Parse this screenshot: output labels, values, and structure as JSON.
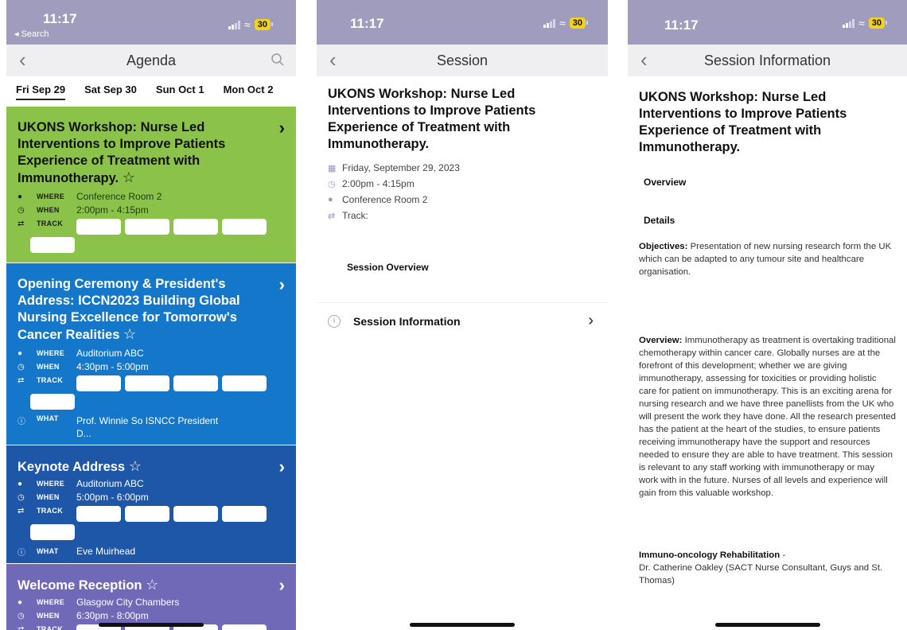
{
  "status": {
    "time": "11:17",
    "back_search": "◂ Search",
    "battery": "30"
  },
  "agenda": {
    "title": "Agenda",
    "days": [
      "Fri Sep 29",
      "Sat Sep 30",
      "Sun Oct 1",
      "Mon Oct 2"
    ],
    "labels": {
      "where": "WHERE",
      "when": "WHEN",
      "track": "TRACK",
      "what": "WHAT"
    },
    "sessions": [
      {
        "title": "UKONS Workshop: Nurse Led Interventions to Improve Patients Experience of Treatment with Immunotherapy.",
        "where": "Conference Room 2",
        "when": "2:00pm - 4:15pm",
        "color": "#8bc34a"
      },
      {
        "title": "Opening Ceremony & President's Address: ICCN2023 Building Global Nursing Excellence for Tomorrow's Cancer Realities",
        "where": "Auditorium ABC",
        "when": "4:30pm - 5:00pm",
        "what": "Prof. Winnie So ISNCC President D...",
        "color": "#1477c9"
      },
      {
        "title": "Keynote Address",
        "where": "Auditorium ABC",
        "when": "5:00pm - 6:00pm",
        "what": "Eve Muirhead",
        "color": "#1e56a8"
      },
      {
        "title": "Welcome Reception",
        "where": "Glasgow City Chambers",
        "when": "6:30pm - 8:00pm",
        "color": "#6f69b8"
      }
    ]
  },
  "session": {
    "title": "Session",
    "heading": "UKONS Workshop: Nurse Led Interventions to Improve Patients Experience of Treatment with Immunotherapy.",
    "date": "Friday, September 29, 2023",
    "time": "2:00pm - 4:15pm",
    "room": "Conference Room 2",
    "track": "Track:",
    "overview_label": "Session Overview",
    "info_label": "Session Information"
  },
  "session_info": {
    "title": "Session Information",
    "heading": "UKONS Workshop: Nurse Led Interventions to Improve Patients Experience of Treatment with Immunotherapy.",
    "overview_label": "Overview",
    "details_label": "Details",
    "objectives_label": "Objectives:",
    "objectives_text": " Presentation of new nursing research form the UK which can be adapted to any tumour site and healthcare organisation.",
    "overview_bold": "Overview:",
    "overview_text": " Immunotherapy as treatment is overtaking traditional chemotherapy within cancer care. Globally nurses are at the forefront of this development; whether we are giving immunotherapy, assessing for toxicities or providing holistic care for patient on immunotherapy. This is an exciting arena for nursing research and we have three panellists from the UK who will present the work they have done. All the research presented has the patient at the heart of the studies, to ensure patients receiving immunotherapy have the support and resources needed to ensure they are able to have treatment. This session is relevant to any staff working with immunotherapy or may work with in the future. Nurses of all levels and experience will gain from this valuable workshop.",
    "rehab_title": "Immuno-oncology Rehabilitation",
    "rehab_dash": " -",
    "rehab_text": "Dr. Catherine Oakley (SACT Nurse Consultant, Guys and St. Thomas)"
  }
}
